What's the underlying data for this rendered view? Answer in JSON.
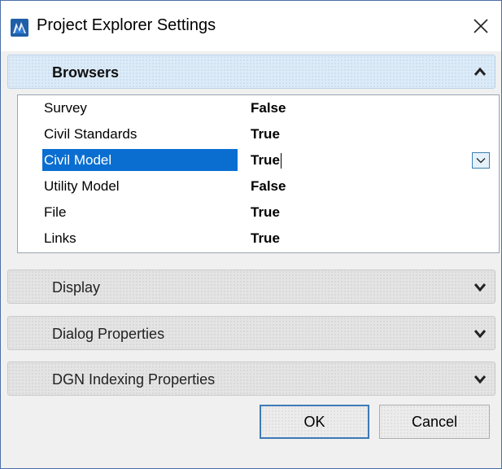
{
  "window": {
    "title": "Project Explorer Settings"
  },
  "icons": {
    "app": "project-explorer-app-icon",
    "close": "close-icon",
    "collapse": "chevron-up-icon",
    "expand": "chevron-down-icon",
    "dropdown": "dropdown-arrow-icon"
  },
  "sections": {
    "browsers": {
      "label": "Browsers"
    },
    "display": {
      "label": "Display"
    },
    "dialog_properties": {
      "label": "Dialog Properties"
    },
    "dgn_indexing": {
      "label": "DGN Indexing Properties"
    }
  },
  "browsers": {
    "rows": [
      {
        "name": "Survey",
        "value": "False"
      },
      {
        "name": "Civil Standards",
        "value": "True"
      },
      {
        "name": "Civil Model",
        "value": "True"
      },
      {
        "name": "Utility Model",
        "value": "False"
      },
      {
        "name": "File",
        "value": "True"
      },
      {
        "name": "Links",
        "value": "True"
      }
    ]
  },
  "buttons": {
    "ok": "OK",
    "cancel": "Cancel"
  },
  "colors": {
    "selection": "#0a6ed1",
    "active_header": "#dcebf8",
    "ok_border": "#3d7ab8"
  }
}
